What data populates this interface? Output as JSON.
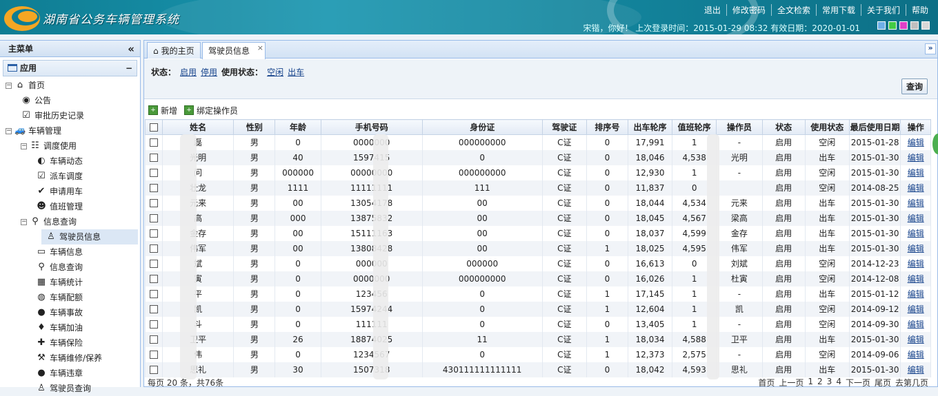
{
  "header": {
    "title": "湖南省公务车辆管理系统",
    "links": [
      "退出",
      "修改密码",
      "全文检索",
      "常用下载",
      "关于我们",
      "帮助"
    ],
    "user_info": "宋锴，你好！ 上次登录时间：2015-01-29 08:32 有效日期：2020-01-01",
    "theme_colors": [
      "#6fb0e8",
      "#44cc44",
      "#e040c8",
      "#c0c0c0",
      "#d8d8d8"
    ]
  },
  "sidebar": {
    "title": "主菜单",
    "collapse_icon": "double-chevron-left-icon",
    "section": "应用",
    "tree": [
      {
        "label": "首页",
        "icon": "home-icon",
        "glyph": "⌂",
        "level": 0,
        "exp": "−"
      },
      {
        "label": "公告",
        "icon": "globe-icon",
        "glyph": "◉",
        "level": 1,
        "exp": ""
      },
      {
        "label": "审批历史记录",
        "icon": "checkbox-icon",
        "glyph": "☑",
        "level": 1,
        "exp": ""
      },
      {
        "label": "车辆管理",
        "icon": "car-icon",
        "glyph": "🚙",
        "level": 0,
        "exp": "−"
      },
      {
        "label": "调度使用",
        "icon": "users-icon",
        "glyph": "☷",
        "level": 1,
        "exp": "−"
      },
      {
        "label": "车辆动态",
        "icon": "dynamic-icon",
        "glyph": "◐",
        "level": 2,
        "exp": ""
      },
      {
        "label": "派车调度",
        "icon": "dispatch-icon",
        "glyph": "☑",
        "level": 2,
        "exp": ""
      },
      {
        "label": "申请用车",
        "icon": "check-icon",
        "glyph": "✔",
        "level": 2,
        "exp": ""
      },
      {
        "label": "值班管理",
        "icon": "duty-icon",
        "glyph": "☻",
        "level": 2,
        "exp": ""
      },
      {
        "label": "信息查询",
        "icon": "magnifier-icon",
        "glyph": "⚲",
        "level": 1,
        "exp": "−"
      },
      {
        "label": "驾驶员信息",
        "icon": "driver-icon",
        "glyph": "♙",
        "level": 2,
        "exp": "",
        "selected": true
      },
      {
        "label": "车辆信息",
        "icon": "vehicle-icon",
        "glyph": "▭",
        "level": 2,
        "exp": ""
      },
      {
        "label": "信息查询",
        "icon": "search-icon",
        "glyph": "⚲",
        "level": 2,
        "exp": ""
      },
      {
        "label": "车辆统计",
        "icon": "excel-icon",
        "glyph": "▦",
        "level": 2,
        "exp": ""
      },
      {
        "label": "车辆配额",
        "icon": "quota-icon",
        "glyph": "◍",
        "level": 2,
        "exp": ""
      },
      {
        "label": "车辆事故",
        "icon": "accident-icon",
        "glyph": "●",
        "level": 2,
        "exp": ""
      },
      {
        "label": "车辆加油",
        "icon": "fuel-drop-icon",
        "glyph": "♦",
        "level": 2,
        "exp": ""
      },
      {
        "label": "车辆保险",
        "icon": "shield-plus-icon",
        "glyph": "✚",
        "level": 2,
        "exp": ""
      },
      {
        "label": "车辆维修/保养",
        "icon": "wrench-icon",
        "glyph": "⚒",
        "level": 2,
        "exp": ""
      },
      {
        "label": "车辆违章",
        "icon": "violation-icon",
        "glyph": "●",
        "level": 2,
        "exp": ""
      },
      {
        "label": "驾驶员查询",
        "icon": "driver-search-icon",
        "glyph": "♙",
        "level": 2,
        "exp": ""
      }
    ]
  },
  "tabs": [
    {
      "label": "我的主页",
      "icon": "home-icon"
    },
    {
      "label": "驾驶员信息",
      "close": "×"
    }
  ],
  "tab_dropdown_icon": "double-chevron-down-icon",
  "filter": {
    "status_label": "状态：",
    "status_options": [
      "启用",
      "停用"
    ],
    "use_status_label": "使用状态：",
    "use_status_options": [
      "空闲",
      "出车"
    ],
    "query_button": "查询"
  },
  "toolbar": {
    "add": "新增",
    "bind": "绑定操作员"
  },
  "table": {
    "columns": [
      "",
      "姓名",
      "性别",
      "年龄",
      "手机号码",
      "身份证",
      "驾驶证",
      "排序号",
      "出车轮序",
      "值班轮序",
      "操作员",
      "状态",
      "使用状态",
      "最后使用日期",
      "操作"
    ],
    "rows": [
      [
        "",
        "磊",
        "男",
        "0",
        "0000000",
        "000000000",
        "C证",
        "0",
        "17,991",
        "1",
        "-",
        "启用",
        "空闲",
        "2015-01-28",
        "编辑"
      ],
      [
        "",
        "光明",
        "男",
        "40",
        "1597415",
        "0",
        "C证",
        "0",
        "18,046",
        "4,538",
        "光明",
        "启用",
        "出车",
        "2015-01-30",
        "编辑"
      ],
      [
        "",
        "问",
        "男",
        "000000",
        "00000000",
        "000000000",
        "C证",
        "0",
        "12,930",
        "1",
        "-",
        "启用",
        "空闲",
        "2015-01-30",
        "编辑"
      ],
      [
        "",
        "壮龙",
        "男",
        "1111",
        "11111111",
        "111",
        "C证",
        "0",
        "11,837",
        "0",
        "",
        "启用",
        "空闲",
        "2014-08-25",
        "编辑"
      ],
      [
        "",
        "元来",
        "男",
        "00",
        "13054178",
        "00",
        "C证",
        "0",
        "18,044",
        "4,534",
        "元来",
        "启用",
        "出车",
        "2015-01-30",
        "编辑"
      ],
      [
        "",
        "高",
        "男",
        "000",
        "13875832",
        "00",
        "C证",
        "0",
        "18,045",
        "4,567",
        "梁高",
        "启用",
        "出车",
        "2015-01-30",
        "编辑"
      ],
      [
        "",
        "金存",
        "男",
        "00",
        "15111163",
        "00",
        "C证",
        "0",
        "18,037",
        "4,599",
        "金存",
        "启用",
        "出车",
        "2015-01-30",
        "编辑"
      ],
      [
        "",
        "伟军",
        "男",
        "00",
        "13808428",
        "00",
        "C证",
        "1",
        "18,025",
        "4,595",
        "伟军",
        "启用",
        "出车",
        "2015-01-30",
        "编辑"
      ],
      [
        "",
        "斌",
        "男",
        "0",
        "000000",
        "000000",
        "C证",
        "0",
        "16,613",
        "0",
        "刘斌",
        "启用",
        "空闲",
        "2014-12-23",
        "编辑"
      ],
      [
        "",
        "寅",
        "男",
        "0",
        "0000000",
        "000000000",
        "C证",
        "0",
        "16,026",
        "1",
        "杜寅",
        "启用",
        "空闲",
        "2014-12-08",
        "编辑"
      ],
      [
        "",
        "平",
        "男",
        "0",
        "123456",
        "0",
        "C证",
        "1",
        "17,145",
        "1",
        "-",
        "启用",
        "出车",
        "2015-01-12",
        "编辑"
      ],
      [
        "",
        "凯",
        "男",
        "0",
        "15974244",
        "0",
        "C证",
        "1",
        "12,604",
        "1",
        "凯",
        "启用",
        "空闲",
        "2014-09-12",
        "编辑"
      ],
      [
        "",
        "斗",
        "男",
        "0",
        "111111",
        "0",
        "C证",
        "0",
        "13,405",
        "1",
        "-",
        "启用",
        "空闲",
        "2014-09-30",
        "编辑"
      ],
      [
        "",
        "卫平",
        "男",
        "26",
        "18874025",
        "11",
        "C证",
        "1",
        "18,034",
        "4,588",
        "卫平",
        "启用",
        "出车",
        "2015-01-30",
        "编辑"
      ],
      [
        "",
        "伟",
        "男",
        "0",
        "1234567",
        "0",
        "C证",
        "1",
        "12,373",
        "2,575",
        "-",
        "启用",
        "空闲",
        "2014-09-06",
        "编辑"
      ],
      [
        "",
        "思礼",
        "男",
        "30",
        "1507318",
        "430111111111111",
        "C证",
        "0",
        "18,042",
        "4,593",
        "思礼",
        "启用",
        "出车",
        "2015-01-30",
        "编辑"
      ]
    ]
  },
  "pager": {
    "left": "每页 20 条，共76条",
    "right": [
      "首页",
      "上一页",
      "1",
      "2",
      "3",
      "4",
      "下一页",
      "尾页",
      "去第几页"
    ]
  }
}
